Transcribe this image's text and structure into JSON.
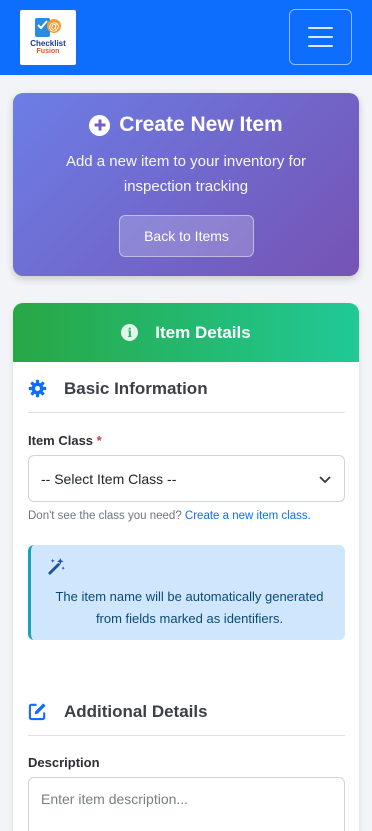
{
  "navbar": {
    "logo_text": "Checklist",
    "logo_subtext": "Fusion",
    "menu_icon": "hamburger-icon",
    "colors": {
      "background": "#0d6efd"
    }
  },
  "hero": {
    "title": "Create New Item",
    "title_icon": "plus-circle-icon",
    "subtitle": "Add a new item to your inventory for inspection tracking",
    "back_button": "Back to Items"
  },
  "card": {
    "header_title": "Item Details",
    "header_icon": "info-circle-icon",
    "basic_section": {
      "title": "Basic Information",
      "icon": "gear-icon",
      "item_class_label": "Item Class",
      "required_mark": "*",
      "item_class_selected": "-- Select Item Class --",
      "help_text": "Don't see the class you need?",
      "help_link": "Create a new item class."
    },
    "alert": {
      "icon": "magic-wand-icon",
      "text": "The item name will be automatically generated from fields marked as identifiers."
    },
    "additional_section": {
      "title": "Additional Details",
      "icon": "edit-icon",
      "description_label": "Description",
      "description_placeholder": "Enter item description..."
    }
  },
  "colors": {
    "hero_gradient_start": "#6c7ee6",
    "hero_gradient_end": "#7553b4",
    "header_gradient_start": "#28a745",
    "header_gradient_end": "#20c997",
    "accent": "#0d6efd",
    "alert_bg": "#cfe6fd"
  }
}
